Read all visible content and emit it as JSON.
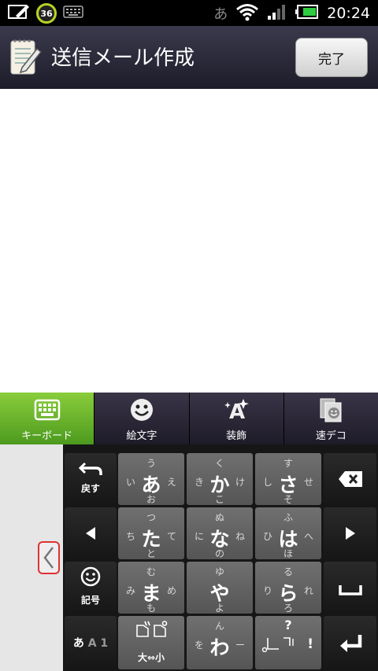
{
  "status_bar": {
    "battery_level_badge": "36",
    "ime_indicator": "あ",
    "time": "20:24"
  },
  "header": {
    "title": "送信メール作成",
    "done_label": "完了"
  },
  "tabs": [
    {
      "label": "キーボード",
      "icon": "keyboard-icon",
      "active": true
    },
    {
      "label": "絵文字",
      "icon": "smiley-icon",
      "active": false
    },
    {
      "label": "装飾",
      "icon": "decoration-icon",
      "active": false
    },
    {
      "label": "速デコ",
      "icon": "quick-deco-icon",
      "active": false
    }
  ],
  "keyboard": {
    "undo_label": "戻す",
    "symbol_label": "記号",
    "mode_label_main": "あ",
    "mode_label_sub": "A 1",
    "case_toggle_label": "大⇔小",
    "kana": {
      "a": {
        "main": "あ",
        "up": "う",
        "left": "い",
        "right": "え",
        "down": "お"
      },
      "ka": {
        "main": "か",
        "up": "く",
        "left": "き",
        "right": "け",
        "down": "こ"
      },
      "sa": {
        "main": "さ",
        "up": "す",
        "left": "し",
        "right": "せ",
        "down": "そ"
      },
      "ta": {
        "main": "た",
        "up": "つ",
        "left": "ち",
        "right": "て",
        "down": "と"
      },
      "na": {
        "main": "な",
        "up": "ぬ",
        "left": "に",
        "right": "ね",
        "down": "の"
      },
      "ha": {
        "main": "は",
        "up": "ふ",
        "left": "ひ",
        "right": "へ",
        "down": "ほ"
      },
      "ma": {
        "main": "ま",
        "up": "む",
        "left": "み",
        "right": "め",
        "down": "も"
      },
      "ya": {
        "main": "や",
        "up": "ゆ",
        "left": "",
        "right": "",
        "down": "よ"
      },
      "ra": {
        "main": "ら",
        "up": "る",
        "left": "り",
        "right": "れ",
        "down": "ろ"
      },
      "wa": {
        "main": "わ",
        "up": "ん",
        "left": "を",
        "right": "ー",
        "down": ""
      }
    },
    "punct": {
      "up": "?",
      "right": "!"
    }
  },
  "colors": {
    "active_tab": "#6ab42c",
    "kana_key": "#606060",
    "func_key": "#1e1e1e",
    "collapse_border": "#d33333"
  }
}
